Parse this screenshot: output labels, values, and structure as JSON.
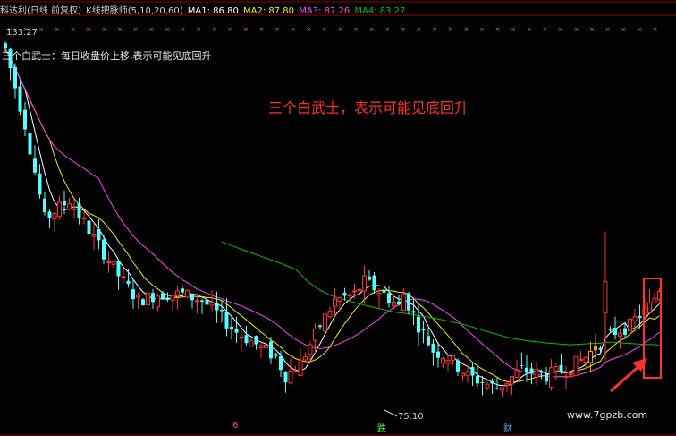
{
  "header": {
    "stock": "科达利(日线 前复权)",
    "indicator": "K线把脉师(5,10,20,60)",
    "ma1_label": "MA1: 86.80",
    "ma2_label": "MA2: 87.80",
    "ma3_label": "MA3: 87.26",
    "ma4_label": "MA4: 83.27"
  },
  "strategy_text": "三个白武士：每日收盘价上移,表示可能见底回升",
  "annotation": "三个白武士，表示可能见底回升",
  "watermark": "www.7gpzb.com",
  "markers": {
    "m1": "6",
    "m2": "跌",
    "m3": "财"
  },
  "colors": {
    "background": "#000000",
    "up": "#ff3030",
    "down": "#54ffff",
    "ma1": "#ffffff",
    "ma2": "#f0f000",
    "ma3": "#ff40ff",
    "ma4": "#00c000",
    "highlight": "#ffa000"
  },
  "chart_data": {
    "type": "candlestick",
    "title": "科达利(日线 前复权)",
    "ylim": [
      72,
      135
    ],
    "price_high_label": "133.27",
    "price_low_label": "75.10",
    "series": [
      {
        "name": "MA1",
        "period": 5,
        "last": 86.8
      },
      {
        "name": "MA2",
        "period": 10,
        "last": 87.8
      },
      {
        "name": "MA3",
        "period": 20,
        "last": 87.26
      },
      {
        "name": "MA4",
        "period": 60,
        "last": 83.27
      }
    ]
  }
}
